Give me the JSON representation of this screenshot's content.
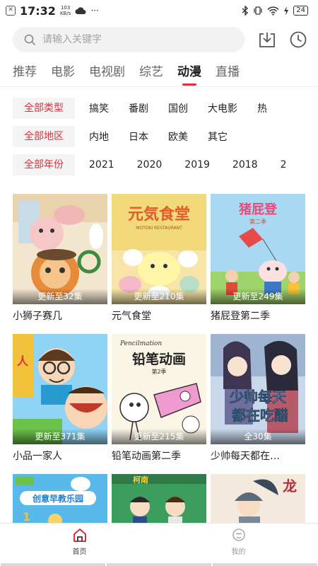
{
  "status_bar": {
    "time": "17:32",
    "speed_value": "103",
    "speed_unit": "KB/s",
    "battery": "24",
    "more": "···"
  },
  "search": {
    "placeholder": "请输入关键字"
  },
  "tabs": [
    {
      "label": "推荐"
    },
    {
      "label": "电影"
    },
    {
      "label": "电视剧"
    },
    {
      "label": "综艺"
    },
    {
      "label": "动漫"
    },
    {
      "label": "直播"
    }
  ],
  "active_tab": "动漫",
  "accent_color": "#d9313a",
  "filters": {
    "type": {
      "label": "全部类型",
      "options": [
        "搞笑",
        "番剧",
        "国创",
        "大电影",
        "热"
      ]
    },
    "region": {
      "label": "全部地区",
      "options": [
        "内地",
        "日本",
        "欧美",
        "其它"
      ]
    },
    "year": {
      "label": "全部年份",
      "options": [
        "2021",
        "2020",
        "2019",
        "2018",
        "2"
      ]
    }
  },
  "cards": [
    {
      "title": "小狮子赛几",
      "badge": "更新至32集"
    },
    {
      "title": "元气食堂",
      "badge": "更新至210集",
      "poster_text": "元気食堂",
      "poster_sub": "MOTOKI RESTAURANT"
    },
    {
      "title": "猪屁登第二季",
      "badge": "更新至249集",
      "poster_text": "猪屁登",
      "poster_sub": "第二季"
    },
    {
      "title": "小品一家人",
      "badge": "更新至371集"
    },
    {
      "title": "铅笔动画第二季",
      "badge": "更新至215集",
      "poster_text": "铅笔动画",
      "poster_sub": "第2季",
      "poster_en": "Pencilmation"
    },
    {
      "title": "少帅每天都在…",
      "badge": "全30集",
      "poster_text": "少帅每天",
      "poster_text2": "都在吃醋"
    },
    {
      "title": "",
      "badge": "",
      "poster_text": "创意早教乐园"
    },
    {
      "title": "",
      "badge": "",
      "poster_text": "柯南"
    },
    {
      "title": "",
      "badge": "",
      "poster_text": "龙"
    }
  ],
  "bottom_nav": [
    {
      "label": "首页",
      "icon": "home-icon"
    },
    {
      "label": "我的",
      "icon": "profile-icon"
    }
  ]
}
